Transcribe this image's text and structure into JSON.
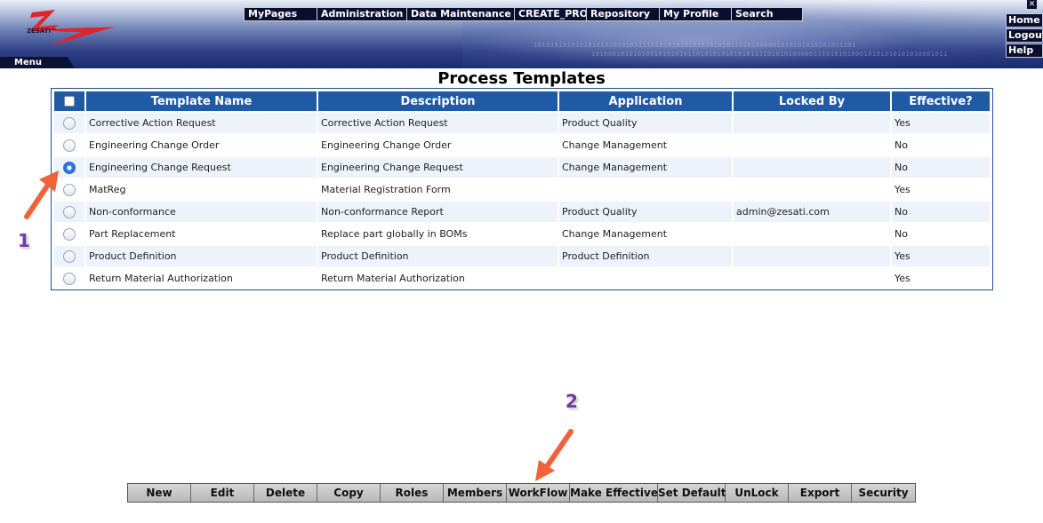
{
  "header": {
    "logo_text": "ZESATI™",
    "menu_label": "Menu",
    "close_label": "✕",
    "binary_line_1": "10101010101010101010101011110101010101010101010110101000001010101010101011101",
    "binary_line_2": "1010001010101001010101011010101010101011110101010000011101010100010101010101010001011",
    "binary_line_3": "1110101010101010110101001011111010101010101010101011100110101010111110101010101010110101010101011101",
    "top_nav": [
      "MyPages",
      "Administration",
      "Data Maintenance",
      "CREATE_PRO",
      "Repository",
      "My Profile",
      "Search"
    ],
    "right_nav": [
      "Home",
      "Logout",
      "Help"
    ]
  },
  "page": {
    "title": "Process Templates"
  },
  "table": {
    "columns": [
      "Template Name",
      "Description",
      "Application",
      "Locked By",
      "Effective?"
    ],
    "rows": [
      {
        "name": "Corrective Action Request",
        "description": "Corrective Action Request",
        "application": "Product Quality",
        "locked_by": "",
        "effective": "Yes",
        "selected": false
      },
      {
        "name": "Engineering Change Order",
        "description": "Engineering Change Order",
        "application": "Change Management",
        "locked_by": "",
        "effective": "No",
        "selected": false
      },
      {
        "name": "Engineering Change Request",
        "description": "Engineering Change Request",
        "application": "Change Management",
        "locked_by": "",
        "effective": "No",
        "selected": true
      },
      {
        "name": "MatReg",
        "description": "Material Registration Form",
        "application": "",
        "locked_by": "",
        "effective": "Yes",
        "selected": false
      },
      {
        "name": "Non-conformance",
        "description": "Non-conformance Report",
        "application": "Product Quality",
        "locked_by": "admin@zesati.com",
        "effective": "No",
        "selected": false
      },
      {
        "name": "Part Replacement",
        "description": "Replace part globally in BOMs",
        "application": "Change Management",
        "locked_by": "",
        "effective": "No",
        "selected": false
      },
      {
        "name": "Product Definition",
        "description": "Product Definition",
        "application": "Product Definition",
        "locked_by": "",
        "effective": "Yes",
        "selected": false
      },
      {
        "name": "Return Material Authorization",
        "description": "Return Material Authorization",
        "application": "",
        "locked_by": "",
        "effective": "Yes",
        "selected": false
      }
    ]
  },
  "annotations": {
    "step_1": "1",
    "step_2": "2",
    "arrow_color": "#f0623a"
  },
  "toolbar": {
    "buttons": [
      "New",
      "Edit",
      "Delete",
      "Copy",
      "Roles",
      "Members",
      "WorkFlow",
      "Make Effective",
      "Set Default",
      "UnLock",
      "Export",
      "Security"
    ]
  },
  "colors": {
    "header_dark": "#1a2a6e",
    "table_header": "#1f5aa6",
    "row_alt": "#eef2fb",
    "annotation_number": "#6a3fa0"
  }
}
